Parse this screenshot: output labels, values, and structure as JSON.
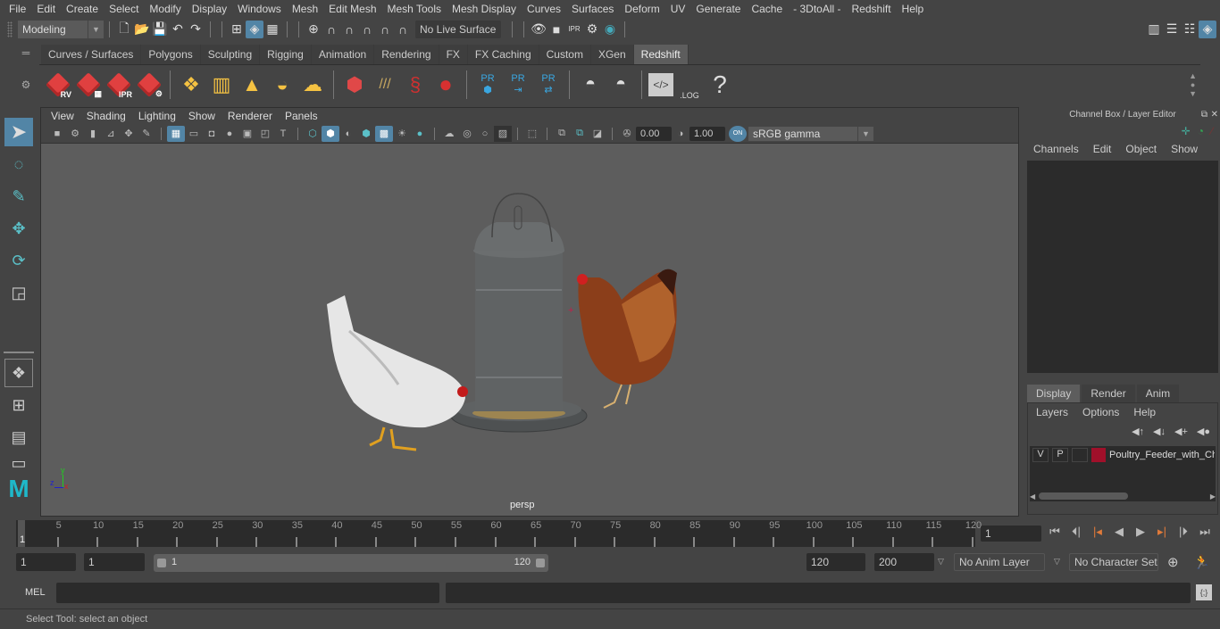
{
  "menubar": {
    "items": [
      "File",
      "Edit",
      "Create",
      "Select",
      "Modify",
      "Display",
      "Windows",
      "Mesh",
      "Edit Mesh",
      "Mesh Tools",
      "Mesh Display",
      "Curves",
      "Surfaces",
      "Deform",
      "UV",
      "Generate",
      "Cache",
      "- 3DtoAll -",
      "Redshift",
      "Help"
    ]
  },
  "statusline": {
    "mode_menu": "Modeling",
    "live_surface": "No Live Surface"
  },
  "shelf": {
    "tabs": [
      "Curves / Surfaces",
      "Polygons",
      "Sculpting",
      "Rigging",
      "Animation",
      "Rendering",
      "FX",
      "FX Caching",
      "Custom",
      "XGen",
      "Redshift"
    ],
    "active_tab": "Redshift",
    "buttons": [
      {
        "icon": "redshift-render-view-icon",
        "label": "RV"
      },
      {
        "icon": "redshift-batch-render-icon",
        "label": ""
      },
      {
        "icon": "redshift-ipr-icon",
        "label": "IPR"
      },
      {
        "icon": "redshift-settings-icon",
        "label": ""
      },
      {
        "icon": "area-light-icon"
      },
      {
        "icon": "portal-light-icon"
      },
      {
        "icon": "spot-light-icon"
      },
      {
        "icon": "dome-light-icon"
      },
      {
        "icon": "sun-sky-icon"
      },
      {
        "icon": "proxy-cube-icon"
      },
      {
        "icon": "hair-icon"
      },
      {
        "icon": "volume-icon"
      },
      {
        "icon": "sphere-material-icon"
      },
      {
        "icon": "proxy-export-icon",
        "label": "PR"
      },
      {
        "icon": "proxy-import-icon",
        "label": "PR"
      },
      {
        "icon": "proxy-swap-icon",
        "label": "PR"
      },
      {
        "icon": "pie-bake-icon"
      },
      {
        "icon": "pie-icon"
      },
      {
        "icon": "script-editor-icon"
      },
      {
        "icon": "log-file-icon",
        "label": ".LOG"
      },
      {
        "icon": "help-icon",
        "label": "?"
      }
    ]
  },
  "viewport": {
    "menu": [
      "View",
      "Shading",
      "Lighting",
      "Show",
      "Renderer",
      "Panels"
    ],
    "exposure": "0.00",
    "gamma": "1.00",
    "color_space": "sRGB gamma",
    "color_mgmt": "ON",
    "camera_label": "persp",
    "axis": {
      "x": "x",
      "y": "y",
      "z": "z"
    }
  },
  "channel_box": {
    "title": "Channel Box / Layer Editor",
    "menu": [
      "Channels",
      "Edit",
      "Object",
      "Show"
    ],
    "layer_tabs": [
      "Display",
      "Render",
      "Anim"
    ],
    "active_layer_tab": "Display",
    "layer_menu": [
      "Layers",
      "Options",
      "Help"
    ],
    "layers": [
      {
        "v": "V",
        "p": "P",
        "color": "#a0102a",
        "name": "Poultry_Feeder_with_Chickens"
      }
    ]
  },
  "timeline": {
    "ticks": [
      5,
      10,
      15,
      20,
      25,
      30,
      35,
      40,
      45,
      50,
      55,
      60,
      65,
      70,
      75,
      80,
      85,
      90,
      95,
      100,
      105,
      110,
      115,
      120
    ],
    "start": 1,
    "end": 120,
    "current_frame_marker": "1",
    "current_frame": "1"
  },
  "range": {
    "start_time": "1",
    "playback_start": "1",
    "slider_start": "1",
    "slider_end": "120",
    "playback_end": "120",
    "end_time": "200",
    "anim_layer": "No Anim Layer",
    "character_set": "No Character Set"
  },
  "command_line": {
    "lang": "MEL",
    "value": "",
    "result": ""
  },
  "help_line": "Select Tool: select an object"
}
